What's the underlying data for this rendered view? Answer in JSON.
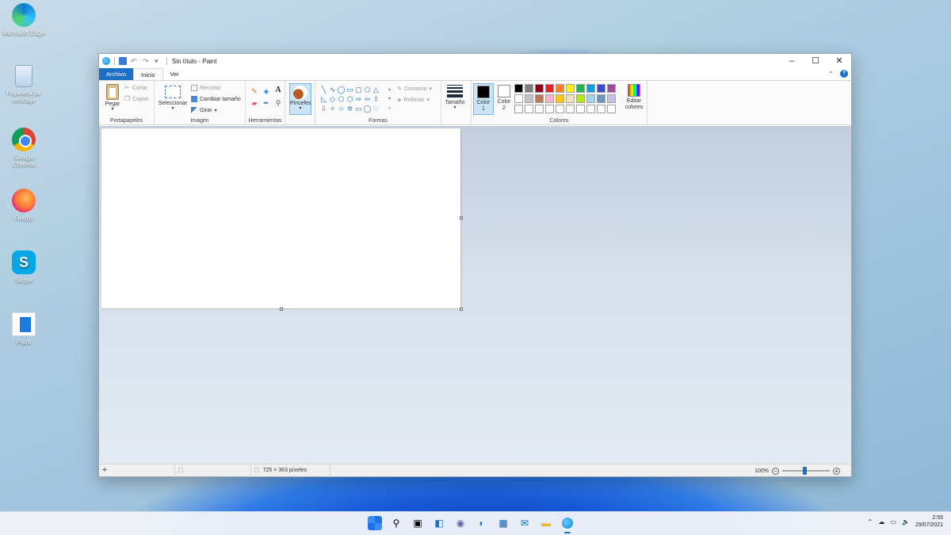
{
  "desktop": {
    "icons": [
      {
        "label": "Microsoft Edge",
        "icon": "edge-icon"
      },
      {
        "label": "Papelera de reciclaje",
        "icon": "recycle-bin-icon"
      },
      {
        "label": "Google Chrome",
        "icon": "chrome-icon"
      },
      {
        "label": "Firefox",
        "icon": "firefox-icon"
      },
      {
        "label": "Skype",
        "icon": "skype-icon"
      },
      {
        "label": "Paint",
        "icon": "paint-icon"
      }
    ]
  },
  "window": {
    "title": "Sin título - Paint",
    "skype_letter": "S"
  },
  "tabs": {
    "file": "Archivo",
    "home": "Inicio",
    "view": "Ver"
  },
  "ribbon": {
    "clipboard": {
      "paste": "Pegar",
      "cut": "Cortar",
      "copy": "Copiar",
      "group": "Portapapeles"
    },
    "image": {
      "select": "Seleccionar",
      "crop": "Recortar",
      "resize": "Cambiar tamaño",
      "rotate": "Girar",
      "group": "Imagen"
    },
    "tools": {
      "group": "Herramientas"
    },
    "brushes": "Pinceles",
    "shapes": {
      "outline": "Contorno",
      "fill": "Rellenar",
      "group": "Formas"
    },
    "size": "Tamaño",
    "colors": {
      "color1": "Color",
      "color1_num": "1",
      "color2": "Color",
      "color2_num": "2",
      "edit1": "Editar",
      "edit2": "colores",
      "group": "Colores",
      "color1_value": "#000000",
      "color2_value": "#ffffff",
      "palette": [
        "#000000",
        "#7f7f7f",
        "#880015",
        "#ed1c24",
        "#ff7f27",
        "#fff200",
        "#22b14c",
        "#00a2e8",
        "#3f48cc",
        "#a349a4",
        "#ffffff",
        "#c3c3c3",
        "#b97a57",
        "#ffaec9",
        "#ffc90e",
        "#efe4b0",
        "#b5e61d",
        "#99d9ea",
        "#7092be",
        "#c8bfe7",
        "#ffffff",
        "#ffffff",
        "#ffffff",
        "#ffffff",
        "#ffffff",
        "#ffffff",
        "#ffffff",
        "#ffffff",
        "#ffffff",
        "#ffffff"
      ]
    }
  },
  "statusbar": {
    "dimensions": "725 × 363 píxeles",
    "zoom": "100%"
  },
  "taskbar": {
    "date": "29/07/2021",
    "time": "2:55"
  }
}
